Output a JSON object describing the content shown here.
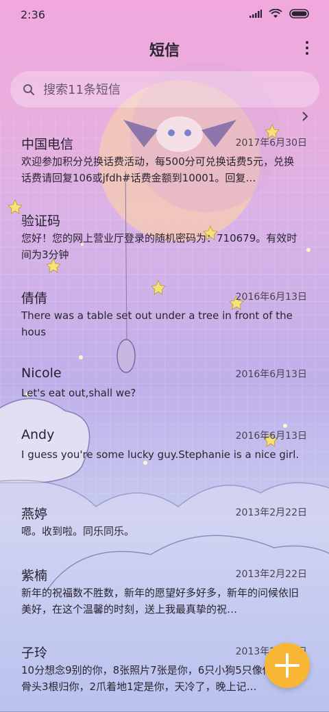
{
  "status": {
    "time": "2:36"
  },
  "header": {
    "title": "短信"
  },
  "search": {
    "placeholder": "搜索11条短信"
  },
  "conversations": [
    {
      "name": "中国电信",
      "date": "2017年6月30日",
      "preview": "欢迎参加积分兑换话费活动，每500分可兑换话费5元，兑换话费请回复106或jfdh#话费金额到10001。回复…"
    },
    {
      "name": "验证码",
      "date": "",
      "preview": "您好！您的网上营业厅登录的随机密码为：710679。有效时间为3分钟"
    },
    {
      "name": "倩倩",
      "date": "2016年6月13日",
      "preview": "There was a table set out under a tree in front of the hous"
    },
    {
      "name": "Nicole",
      "date": "2016年6月13日",
      "preview": "Let's eat out,shall we?"
    },
    {
      "name": "Andy",
      "date": "2016年6月13日",
      "preview": "I guess you're some lucky guy.Stephanie is a nice girl."
    },
    {
      "name": "燕婷",
      "date": "2013年2月22日",
      "preview": "嗯。收到啦。同乐同乐。"
    },
    {
      "name": "紫楠",
      "date": "2013年2月22日",
      "preview": "新年的祝福数不胜数，新年的愿望好多好多，新年的问候依旧美好，在这个温馨的时刻，送上我最真挚的祝…"
    },
    {
      "name": "子玲",
      "date": "2013年2月22日",
      "preview": "10分想念9别的你，8张照片7张是你，6只小狗5只像你，4根骨头3根归你，2爪着地1定是你，天冷了，晚上记…"
    }
  ],
  "icons": {
    "search": "search-icon",
    "more": "more-vertical-icon",
    "compose": "plus-icon",
    "chevron": "chevron-right-icon"
  },
  "colors": {
    "accent": "#f7b634",
    "header_bg": "#f0a8dd"
  }
}
